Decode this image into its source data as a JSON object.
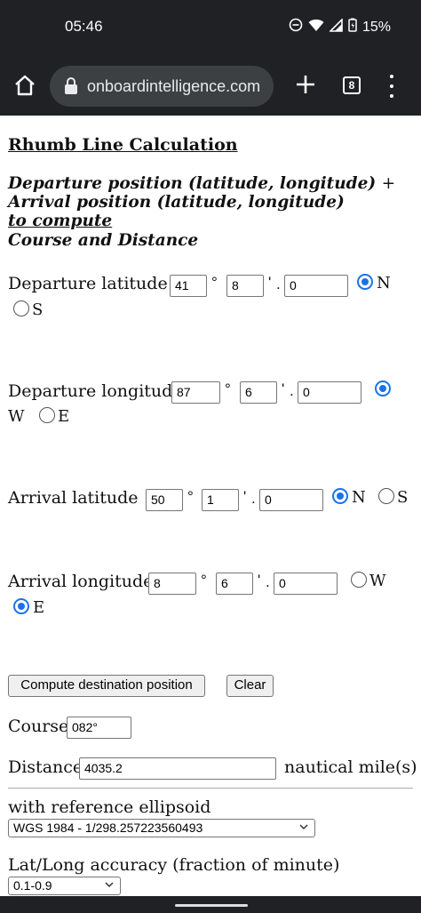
{
  "status_bar": {
    "time": "05:46",
    "battery": "15%"
  },
  "browser": {
    "url": "onboardintelligence.com",
    "tab_count": "8"
  },
  "page": {
    "title": "Rhumb Line Calculation",
    "intro": {
      "line1": "Departure position (latitude, longitude)",
      "plus": "+",
      "line2": "Arrival position (latitude, longitude)",
      "line3": "to compute",
      "line4": "Course and Distance"
    },
    "symbols": {
      "degree": "°",
      "minute": "'",
      "dot": "."
    },
    "departure_latitude": {
      "label": "Departure latitude",
      "deg": "41",
      "min": "8",
      "frac": "0",
      "options": [
        {
          "label": "N",
          "checked": true
        },
        {
          "label": "S",
          "checked": false
        }
      ]
    },
    "departure_longitude": {
      "label": "Departure longitude",
      "deg": "87",
      "min": "6",
      "frac": "0",
      "options": [
        {
          "label": "W",
          "checked": true
        },
        {
          "label": "E",
          "checked": false
        }
      ]
    },
    "arrival_latitude": {
      "label": "Arrival latitude",
      "deg": "50",
      "min": "1",
      "frac": "0",
      "options": [
        {
          "label": "N",
          "checked": true
        },
        {
          "label": "S",
          "checked": false
        }
      ]
    },
    "arrival_longitude": {
      "label": "Arrival longitude",
      "deg": "8",
      "min": "6",
      "frac": "0",
      "options": [
        {
          "label": "W",
          "checked": false
        },
        {
          "label": "E",
          "checked": true
        }
      ]
    },
    "buttons": {
      "compute": "Compute destination position",
      "clear": "Clear"
    },
    "course": {
      "label": "Course",
      "value": "082°"
    },
    "distance": {
      "label": "Distance",
      "value": "4035.2",
      "unit": "nautical mile(s)"
    },
    "ellipsoid": {
      "label": "with reference ellipsoid",
      "selected": "WGS 1984 - 1/298.257223560493"
    },
    "accuracy": {
      "label": "Lat/Long accuracy (fraction of minute)",
      "selected": "0.1-0.9"
    }
  }
}
